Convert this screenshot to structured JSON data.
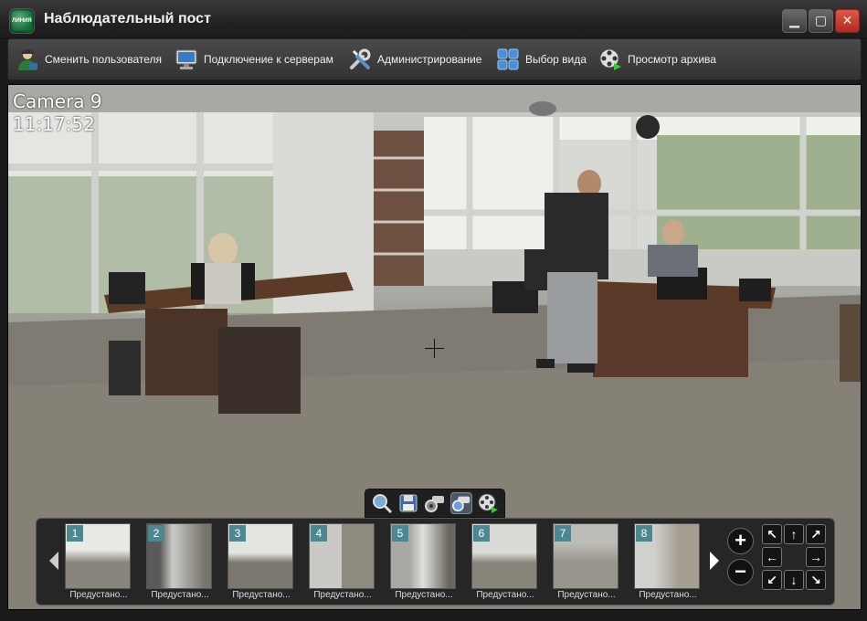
{
  "window": {
    "title": "Наблюдательный пост",
    "logo_text": "ЛИНИЯ",
    "min_symbol": "▁",
    "max_symbol": "▢",
    "close_symbol": "✕"
  },
  "toolbar": {
    "items": [
      {
        "label": "Сменить пользователя",
        "icon": "user-icon"
      },
      {
        "label": "Подключение к серверам",
        "icon": "monitor-icon"
      },
      {
        "label": "Администрирование",
        "icon": "tools-icon"
      },
      {
        "label": "Выбор вида",
        "icon": "grid-icon"
      },
      {
        "label": "Просмотр архива",
        "icon": "film-reel-icon"
      }
    ]
  },
  "camera": {
    "name": "Camera 9",
    "time": "11:17:52"
  },
  "video_controls": [
    "zoom-icon",
    "save-icon",
    "settings-camera-icon",
    "camera-eye-icon",
    "archive-reel-icon"
  ],
  "thumbnails": [
    {
      "num": "1",
      "caption": "Предустано..."
    },
    {
      "num": "2",
      "caption": "Предустано..."
    },
    {
      "num": "3",
      "caption": "Предустано..."
    },
    {
      "num": "4",
      "caption": "Предустано..."
    },
    {
      "num": "5",
      "caption": "Предустано..."
    },
    {
      "num": "6",
      "caption": "Предустано..."
    },
    {
      "num": "7",
      "caption": "Предустано..."
    },
    {
      "num": "8",
      "caption": "Предустано..."
    }
  ],
  "ptz": {
    "zoom_in": "+",
    "zoom_out": "−",
    "up_left": "↖",
    "up": "↑",
    "up_right": "↗",
    "left": "←",
    "right": "→",
    "down_left": "↙",
    "down": "↓",
    "down_right": "↘"
  }
}
